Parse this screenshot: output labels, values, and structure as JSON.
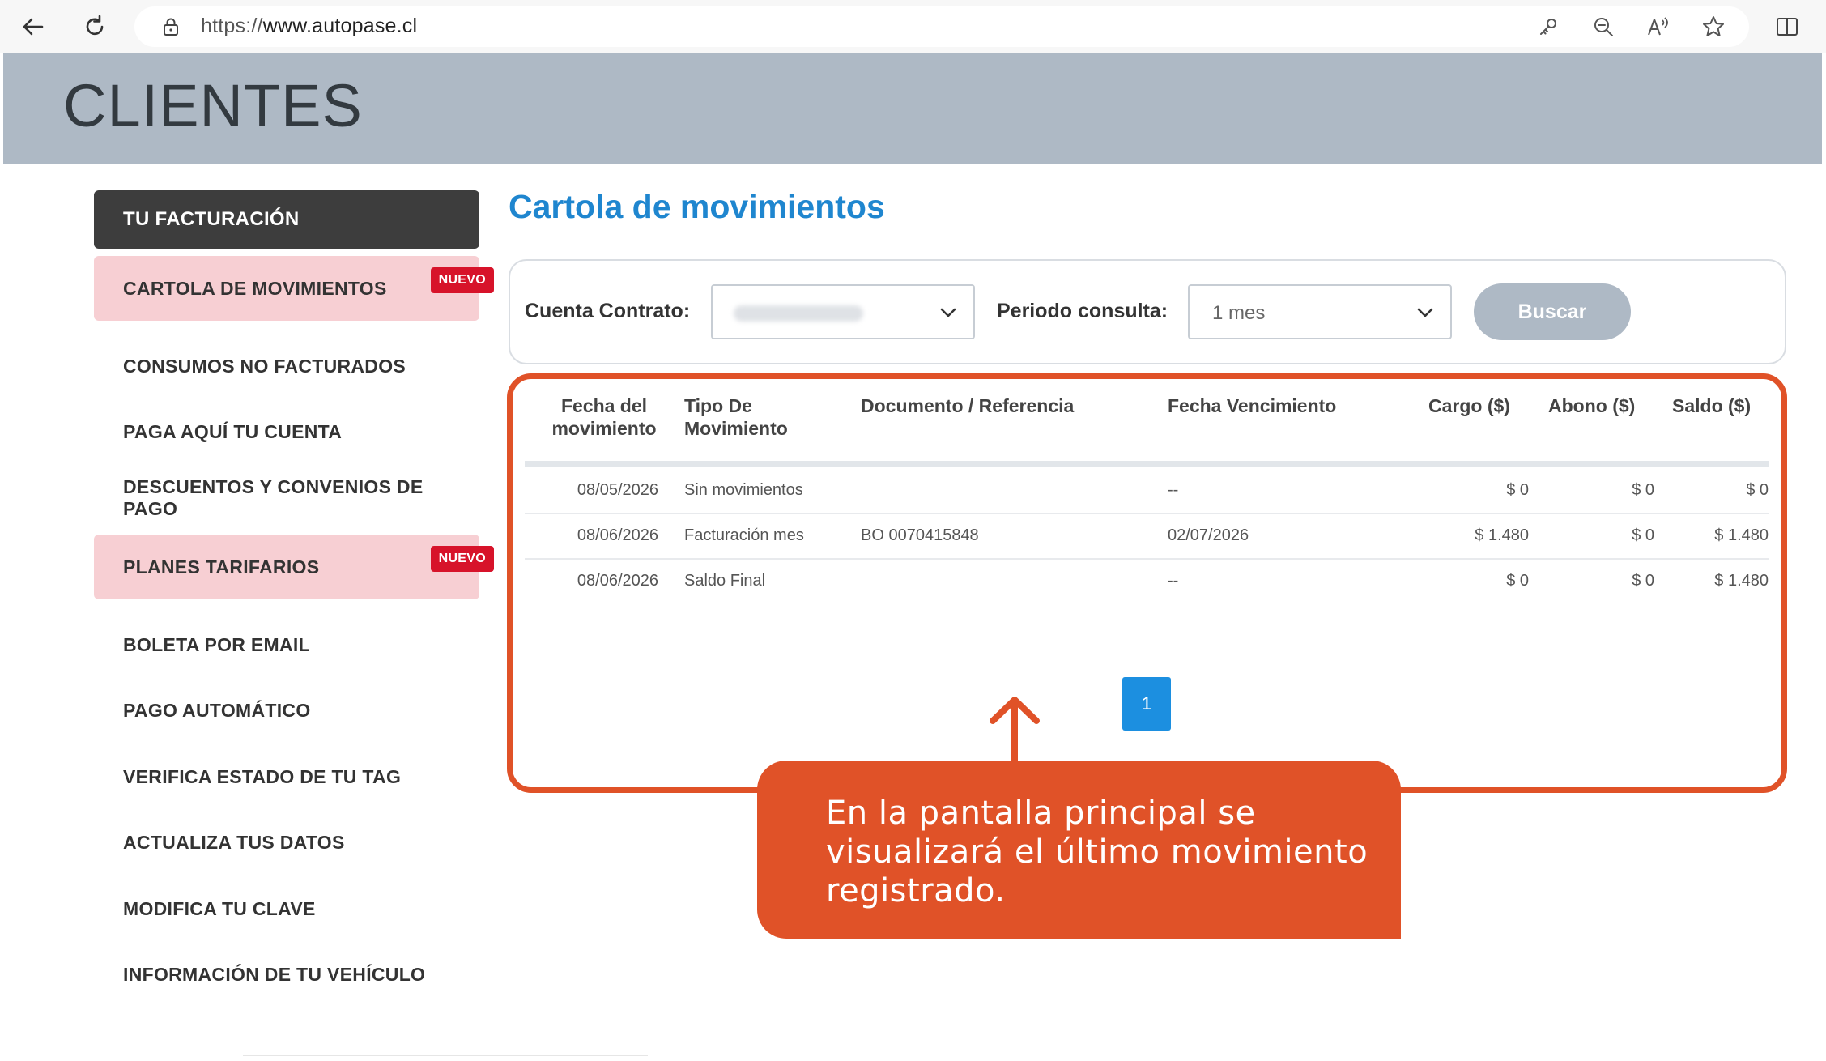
{
  "browser": {
    "url_scheme": "https://",
    "url_host": "www.autopase.cl",
    "icons": [
      "back-arrow-icon",
      "refresh-icon",
      "lock-icon",
      "key-icon",
      "zoom-out-icon",
      "read-aloud-icon",
      "favorite-star-icon",
      "split-screen-icon"
    ]
  },
  "header": {
    "title": "CLIENTES"
  },
  "sidebar": {
    "title": "TU FACTURACIÓN",
    "items": [
      {
        "label": "CARTOLA DE MOVIMIENTOS",
        "badge": "NUEVO"
      },
      {
        "label": "CONSUMOS NO FACTURADOS"
      },
      {
        "label": "PAGA AQUÍ TU CUENTA"
      },
      {
        "label": "DESCUENTOS Y CONVENIOS DE PAGO"
      },
      {
        "label": "PLANES TARIFARIOS",
        "badge": "NUEVO"
      },
      {
        "label": "BOLETA POR EMAIL"
      },
      {
        "label": "PAGO AUTOMÁTICO"
      },
      {
        "label": "VERIFICA ESTADO DE TU TAG"
      },
      {
        "label": "ACTUALIZA TUS DATOS"
      },
      {
        "label": "MODIFICA TU CLAVE"
      },
      {
        "label": "INFORMACIÓN DE TU VEHÍCULO"
      }
    ]
  },
  "main": {
    "title": "Cartola de movimientos",
    "filters": {
      "cuenta_label": "Cuenta Contrato:",
      "periodo_label": "Periodo consulta:",
      "periodo_value": "1 mes",
      "search_button": "Buscar"
    },
    "table": {
      "headers": [
        {
          "line1": "Fecha del",
          "line2": "movimiento"
        },
        {
          "line1": "Tipo De",
          "line2": "Movimiento"
        },
        {
          "line1": "Documento / Referencia",
          "line2": ""
        },
        {
          "line1": "Fecha Vencimiento",
          "line2": ""
        },
        {
          "line1": "Cargo ($)",
          "line2": ""
        },
        {
          "line1": "Abono ($)",
          "line2": ""
        },
        {
          "line1": "Saldo ($)",
          "line2": ""
        }
      ],
      "rows": [
        {
          "fecha": "08/05/2026",
          "tipo": "Sin movimientos",
          "documento": "",
          "vencimiento": "--",
          "cargo": "$ 0",
          "abono": "$ 0",
          "saldo": "$ 0"
        },
        {
          "fecha": "08/06/2026",
          "tipo": "Facturación mes",
          "documento": "BO 0070415848",
          "vencimiento": "02/07/2026",
          "cargo": "$ 1.480",
          "abono": "$ 0",
          "saldo": "$ 1.480"
        },
        {
          "fecha": "08/06/2026",
          "tipo": "Saldo Final",
          "documento": "",
          "vencimiento": "--",
          "cargo": "$ 0",
          "abono": "$ 0",
          "saldo": "$ 1.480"
        }
      ]
    },
    "pagination": {
      "current_page": "1"
    }
  },
  "callout": {
    "text": "En la pantalla principal se visualizará el último movimiento registrado."
  },
  "colors": {
    "header_band": "#aeb9c5",
    "sidebar_title_bg": "#3d3d3d",
    "highlight_pink": "#f7cfd3",
    "badge_red": "#d7132a",
    "title_blue": "#1f86cf",
    "accent_orange": "#e05228",
    "page_button_blue": "#1c8fe0"
  }
}
